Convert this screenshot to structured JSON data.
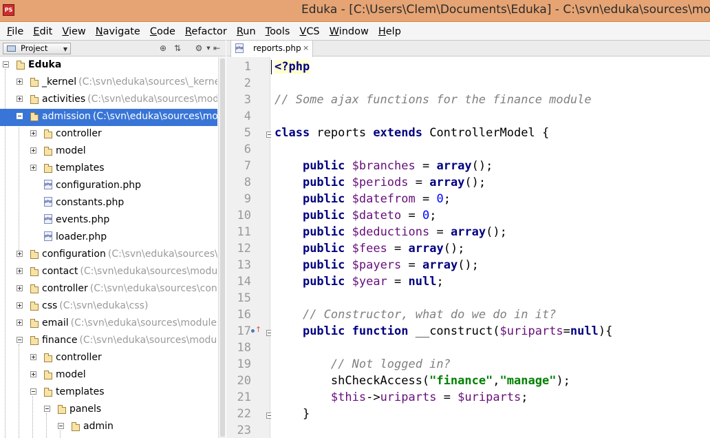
{
  "window": {
    "title": "Eduka - [C:\\Users\\Clem\\Documents\\Eduka] - C:\\svn\\eduka\\sources\\mo",
    "app_icon_label": "PS"
  },
  "menu": [
    "File",
    "Edit",
    "View",
    "Navigate",
    "Code",
    "Refactor",
    "Run",
    "Tools",
    "VCS",
    "Window",
    "Help"
  ],
  "project_panel": {
    "view_selector": "Project",
    "tree": [
      {
        "depth": 0,
        "type": "folder",
        "expanded": true,
        "name": "Eduka",
        "path": "",
        "bold": true
      },
      {
        "depth": 1,
        "type": "folder",
        "expanded": false,
        "name": "_kernel",
        "path": "(C:\\svn\\eduka\\sources\\_kernel)"
      },
      {
        "depth": 1,
        "type": "folder",
        "expanded": false,
        "name": "activities",
        "path": "(C:\\svn\\eduka\\sources\\modul"
      },
      {
        "depth": 1,
        "type": "folder",
        "expanded": true,
        "name": "admission",
        "path": "(C:\\svn\\eduka\\sources\\modu",
        "selected": true
      },
      {
        "depth": 2,
        "type": "folder",
        "expanded": false,
        "name": "controller",
        "path": ""
      },
      {
        "depth": 2,
        "type": "folder",
        "expanded": false,
        "name": "model",
        "path": ""
      },
      {
        "depth": 2,
        "type": "folder",
        "expanded": false,
        "name": "templates",
        "path": ""
      },
      {
        "depth": 2,
        "type": "file",
        "name": "configuration.php",
        "path": ""
      },
      {
        "depth": 2,
        "type": "file",
        "name": "constants.php",
        "path": ""
      },
      {
        "depth": 2,
        "type": "file",
        "name": "events.php",
        "path": ""
      },
      {
        "depth": 2,
        "type": "file",
        "name": "loader.php",
        "path": ""
      },
      {
        "depth": 1,
        "type": "folder",
        "expanded": false,
        "name": "configuration",
        "path": "(C:\\svn\\eduka\\sources\\m"
      },
      {
        "depth": 1,
        "type": "folder",
        "expanded": false,
        "name": "contact",
        "path": "(C:\\svn\\eduka\\sources\\module"
      },
      {
        "depth": 1,
        "type": "folder",
        "expanded": false,
        "name": "controller",
        "path": "(C:\\svn\\eduka\\sources\\contr"
      },
      {
        "depth": 1,
        "type": "folder",
        "expanded": false,
        "name": "css",
        "path": "(C:\\svn\\eduka\\css)"
      },
      {
        "depth": 1,
        "type": "folder",
        "expanded": false,
        "name": "email",
        "path": "(C:\\svn\\eduka\\sources\\modules\\"
      },
      {
        "depth": 1,
        "type": "folder",
        "expanded": true,
        "name": "finance",
        "path": "(C:\\svn\\eduka\\sources\\module"
      },
      {
        "depth": 2,
        "type": "folder",
        "expanded": false,
        "name": "controller",
        "path": ""
      },
      {
        "depth": 2,
        "type": "folder",
        "expanded": false,
        "name": "model",
        "path": ""
      },
      {
        "depth": 2,
        "type": "folder",
        "expanded": true,
        "name": "templates",
        "path": ""
      },
      {
        "depth": 3,
        "type": "folder",
        "expanded": true,
        "name": "panels",
        "path": ""
      },
      {
        "depth": 4,
        "type": "folder",
        "expanded": true,
        "name": "admin",
        "path": ""
      }
    ]
  },
  "editor": {
    "tab": {
      "label": "reports.php",
      "close": "×",
      "icon": "php-file-icon",
      "icon_label": "php"
    },
    "lines": [
      {
        "n": "1",
        "tokens": [
          [
            "ph",
            "<?php"
          ]
        ]
      },
      {
        "n": "2",
        "tokens": []
      },
      {
        "n": "3",
        "tokens": [
          [
            "com",
            "// Some ajax functions for the finance module"
          ]
        ]
      },
      {
        "n": "4",
        "tokens": []
      },
      {
        "n": "5",
        "fold": true,
        "tokens": [
          [
            "kw",
            "class"
          ],
          [
            "cls",
            " reports "
          ],
          [
            "kw",
            "extends"
          ],
          [
            "cls",
            " ControllerModel {"
          ]
        ]
      },
      {
        "n": "6",
        "tokens": []
      },
      {
        "n": "7",
        "tokens": [
          [
            "cls",
            "    "
          ],
          [
            "kw",
            "public"
          ],
          [
            "cls",
            " "
          ],
          [
            "var",
            "$branches"
          ],
          [
            "cls",
            " = "
          ],
          [
            "kw",
            "array"
          ],
          [
            "cls",
            "();"
          ]
        ]
      },
      {
        "n": "8",
        "tokens": [
          [
            "cls",
            "    "
          ],
          [
            "kw",
            "public"
          ],
          [
            "cls",
            " "
          ],
          [
            "var",
            "$periods"
          ],
          [
            "cls",
            " = "
          ],
          [
            "kw",
            "array"
          ],
          [
            "cls",
            "();"
          ]
        ]
      },
      {
        "n": "9",
        "tokens": [
          [
            "cls",
            "    "
          ],
          [
            "kw",
            "public"
          ],
          [
            "cls",
            " "
          ],
          [
            "var",
            "$datefrom"
          ],
          [
            "cls",
            " = "
          ],
          [
            "num",
            "0"
          ],
          [
            "cls",
            ";"
          ]
        ]
      },
      {
        "n": "10",
        "tokens": [
          [
            "cls",
            "    "
          ],
          [
            "kw",
            "public"
          ],
          [
            "cls",
            " "
          ],
          [
            "var",
            "$dateto"
          ],
          [
            "cls",
            " = "
          ],
          [
            "num",
            "0"
          ],
          [
            "cls",
            ";"
          ]
        ]
      },
      {
        "n": "11",
        "tokens": [
          [
            "cls",
            "    "
          ],
          [
            "kw",
            "public"
          ],
          [
            "cls",
            " "
          ],
          [
            "var",
            "$deductions"
          ],
          [
            "cls",
            " = "
          ],
          [
            "kw",
            "array"
          ],
          [
            "cls",
            "();"
          ]
        ]
      },
      {
        "n": "12",
        "tokens": [
          [
            "cls",
            "    "
          ],
          [
            "kw",
            "public"
          ],
          [
            "cls",
            " "
          ],
          [
            "var",
            "$fees"
          ],
          [
            "cls",
            " = "
          ],
          [
            "kw",
            "array"
          ],
          [
            "cls",
            "();"
          ]
        ]
      },
      {
        "n": "13",
        "tokens": [
          [
            "cls",
            "    "
          ],
          [
            "kw",
            "public"
          ],
          [
            "cls",
            " "
          ],
          [
            "var",
            "$payers"
          ],
          [
            "cls",
            " = "
          ],
          [
            "kw",
            "array"
          ],
          [
            "cls",
            "();"
          ]
        ]
      },
      {
        "n": "14",
        "tokens": [
          [
            "cls",
            "    "
          ],
          [
            "kw",
            "public"
          ],
          [
            "cls",
            " "
          ],
          [
            "var",
            "$year"
          ],
          [
            "cls",
            " = "
          ],
          [
            "kw",
            "null"
          ],
          [
            "cls",
            ";"
          ]
        ]
      },
      {
        "n": "15",
        "tokens": []
      },
      {
        "n": "16",
        "tokens": [
          [
            "cls",
            "    "
          ],
          [
            "com",
            "// Constructor, what do we do in it?"
          ]
        ]
      },
      {
        "n": "17",
        "fold": true,
        "override": true,
        "tokens": [
          [
            "cls",
            "    "
          ],
          [
            "kw",
            "public function"
          ],
          [
            "cls",
            " __construct("
          ],
          [
            "var",
            "$uriparts"
          ],
          [
            "cls",
            "="
          ],
          [
            "kw",
            "null"
          ],
          [
            "cls",
            "){"
          ]
        ]
      },
      {
        "n": "18",
        "tokens": []
      },
      {
        "n": "19",
        "tokens": [
          [
            "cls",
            "        "
          ],
          [
            "com",
            "// Not logged in?"
          ]
        ]
      },
      {
        "n": "20",
        "tokens": [
          [
            "cls",
            "        shCheckAccess("
          ],
          [
            "str",
            "\"finance\""
          ],
          [
            "cls",
            ","
          ],
          [
            "str",
            "\"manage\""
          ],
          [
            "cls",
            ");"
          ]
        ]
      },
      {
        "n": "21",
        "tokens": [
          [
            "cls",
            "        "
          ],
          [
            "var",
            "$this"
          ],
          [
            "cls",
            "->"
          ],
          [
            "var",
            "uriparts"
          ],
          [
            "cls",
            " = "
          ],
          [
            "var",
            "$uriparts"
          ],
          [
            "cls",
            ";"
          ]
        ]
      },
      {
        "n": "22",
        "fold": true,
        "tokens": [
          [
            "cls",
            "    }"
          ]
        ]
      },
      {
        "n": "23",
        "tokens": []
      }
    ]
  },
  "colors": {
    "title_bar": "#e6a474",
    "selection": "#3875d7",
    "keyword": "#000080",
    "variable": "#660e7a",
    "string": "#008000",
    "comment": "#808080",
    "number": "#0000ff"
  }
}
